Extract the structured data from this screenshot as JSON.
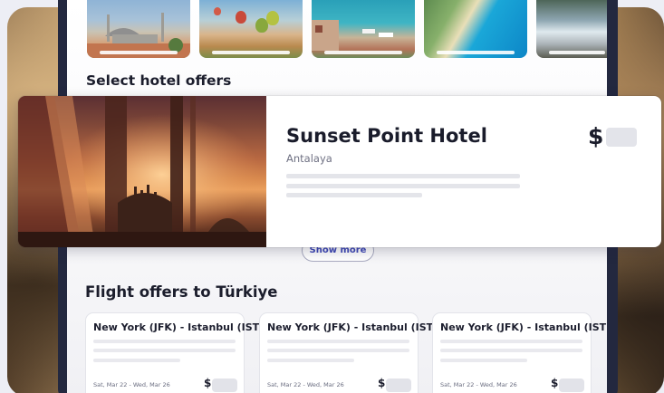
{
  "sections": {
    "hotels_title": "Select hotel offers",
    "show_more_label": "Show more",
    "flights_title": "Flight offers to Türkiye"
  },
  "hotel_card": {
    "name": "Sunset Point Hotel",
    "city": "Antalaya",
    "currency": "$"
  },
  "flight_cards": [
    {
      "route": "New York (JFK) - Istanbul (IST)",
      "dates": "Sat, Mar 22 - Wed, Mar 26",
      "currency": "$"
    },
    {
      "route": "New York (JFK) - Istanbul (IST)",
      "dates": "Sat, Mar 22 - Wed, Mar 26",
      "currency": "$"
    },
    {
      "route": "New York (JFK) - Istanbul (IST)",
      "dates": "Sat, Mar 22 - Wed, Mar 26",
      "currency": "$"
    }
  ],
  "colors": {
    "accent": "#3f49b8",
    "device_frame": "#23283f",
    "text_primary": "#1b1d2c",
    "placeholder": "#e4e5ea"
  }
}
